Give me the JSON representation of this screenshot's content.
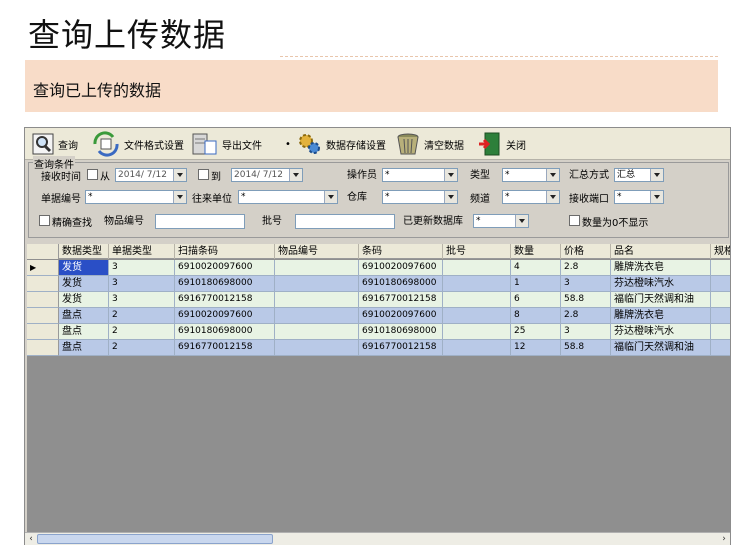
{
  "page_title": "查询上传数据",
  "subtitle": "查询已上传的数据",
  "toolbar": {
    "query": "查询",
    "file_format": "文件格式设置",
    "export": "导出文件",
    "storage": "数据存储设置",
    "clear": "清空数据",
    "close": "关闭",
    "more": "•"
  },
  "filters": {
    "group_title": "查询条件",
    "recv_time": "接收时间",
    "from": "从",
    "date_from": "2014/ 7/12",
    "to": "到",
    "date_to": "2014/ 7/12",
    "operator": "操作员",
    "operator_val": "*",
    "category": "类型",
    "category_val": "*",
    "summary": "汇总方式",
    "summary_val": "汇总",
    "doc_no": "单据编号",
    "doc_no_val": "*",
    "partner": "往来单位",
    "partner_val": "*",
    "warehouse": "仓库",
    "warehouse_val": "*",
    "channel": "频道",
    "channel_val": "*",
    "port": "接收端口",
    "port_val": "*",
    "exact": "精确查找",
    "item_no": "物品编号",
    "batch": "批号",
    "updated_db": "已更新数据库",
    "updated_db_val": "*",
    "hide_zero": "数量为0不显示"
  },
  "table": {
    "columns": [
      "数据类型",
      "单据类型",
      "扫描条码",
      "物品编号",
      "条码",
      "批号",
      "数量",
      "价格",
      "品名",
      "规格"
    ],
    "rows": [
      [
        "发货",
        "3",
        "6910020097600",
        "",
        "6910020097600",
        "",
        "4",
        "2.8",
        "雕牌洗衣皂",
        ""
      ],
      [
        "发货",
        "3",
        "6910180698000",
        "",
        "6910180698000",
        "",
        "1",
        "3",
        "芬达橙味汽水",
        ""
      ],
      [
        "发货",
        "3",
        "6916770012158",
        "",
        "6916770012158",
        "",
        "6",
        "58.8",
        "福临门天然调和油",
        ""
      ],
      [
        "盘点",
        "2",
        "6910020097600",
        "",
        "6910020097600",
        "",
        "8",
        "2.8",
        "雕牌洗衣皂",
        ""
      ],
      [
        "盘点",
        "2",
        "6910180698000",
        "",
        "6910180698000",
        "",
        "25",
        "3",
        "芬达橙味汽水",
        ""
      ],
      [
        "盘点",
        "2",
        "6916770012158",
        "",
        "6916770012158",
        "",
        "12",
        "58.8",
        "福临门天然调和油",
        ""
      ]
    ],
    "current_row_marker": "▶"
  },
  "scroll": {
    "left": "‹",
    "right": "›"
  },
  "colors": {
    "row_light": "#e8f3e4",
    "row_blue": "#b9c9e7",
    "selected_cell": "#2a4fc6",
    "subtitle_bg": "#f8dcc8"
  }
}
